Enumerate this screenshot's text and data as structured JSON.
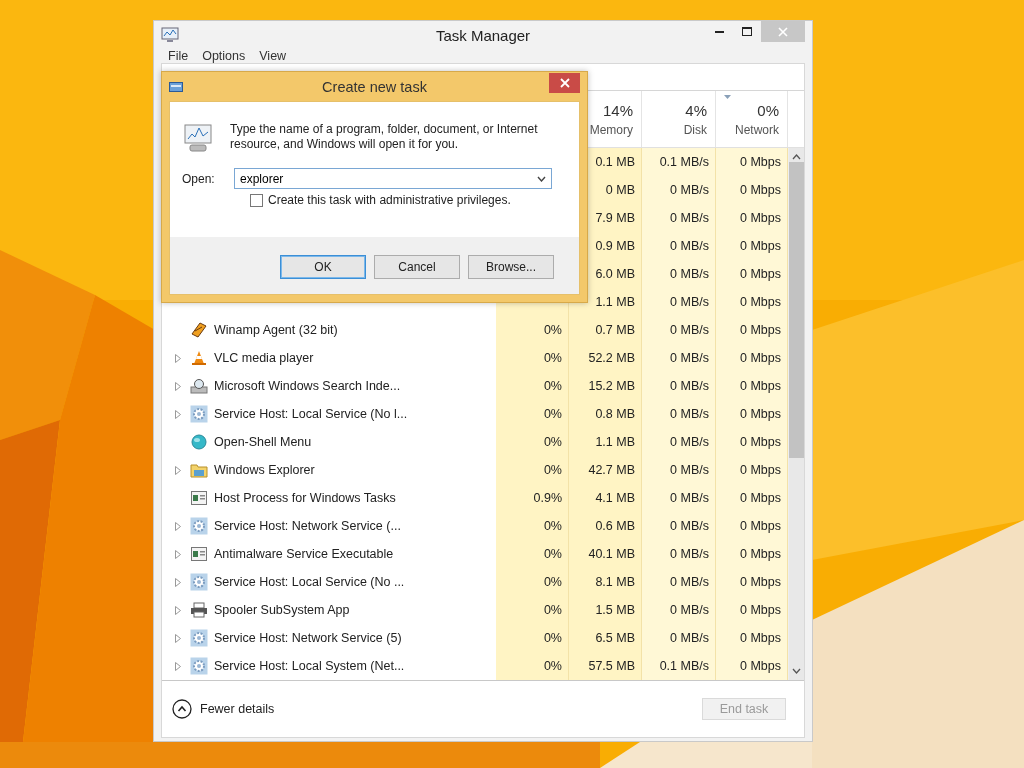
{
  "window": {
    "title": "Task Manager"
  },
  "menu": [
    "File",
    "Options",
    "View"
  ],
  "columns": [
    {
      "percent": "14%",
      "label": "Memory",
      "sorted": false
    },
    {
      "percent": "4%",
      "label": "Disk",
      "sorted": false
    },
    {
      "percent": "0%",
      "label": "Network",
      "sorted": true
    }
  ],
  "rows": [
    {
      "memory": "0.1 MB",
      "disk": "0.1 MB/s",
      "network": "0 Mbps",
      "expandable": false
    },
    {
      "memory": "0 MB",
      "disk": "0 MB/s",
      "network": "0 Mbps",
      "expandable": false
    },
    {
      "memory": "7.9 MB",
      "disk": "0 MB/s",
      "network": "0 Mbps",
      "expandable": false
    },
    {
      "memory": "0.9 MB",
      "disk": "0 MB/s",
      "network": "0 Mbps",
      "expandable": false
    },
    {
      "memory": "6.0 MB",
      "disk": "0 MB/s",
      "network": "0 Mbps",
      "expandable": false
    },
    {
      "memory": "1.1 MB",
      "disk": "0 MB/s",
      "network": "0 Mbps",
      "expandable": false
    },
    {
      "kind": "winamp",
      "name": "Winamp Agent (32 bit)",
      "cpu": "0%",
      "memory": "0.7 MB",
      "disk": "0 MB/s",
      "network": "0 Mbps",
      "expandable": false
    },
    {
      "kind": "cone",
      "name": "VLC media player",
      "cpu": "0%",
      "memory": "52.2 MB",
      "disk": "0 MB/s",
      "network": "0 Mbps",
      "expandable": true
    },
    {
      "kind": "search",
      "name": "Microsoft Windows Search Inde...",
      "cpu": "0%",
      "memory": "15.2 MB",
      "disk": "0 MB/s",
      "network": "0 Mbps",
      "expandable": true
    },
    {
      "kind": "service",
      "name": "Service Host: Local Service (No l...",
      "cpu": "0%",
      "memory": "0.8 MB",
      "disk": "0 MB/s",
      "network": "0 Mbps",
      "expandable": true
    },
    {
      "kind": "shell",
      "name": "Open-Shell Menu",
      "cpu": "0%",
      "memory": "1.1 MB",
      "disk": "0 MB/s",
      "network": "0 Mbps",
      "expandable": false
    },
    {
      "kind": "folder",
      "name": "Windows Explorer",
      "cpu": "0%",
      "memory": "42.7 MB",
      "disk": "0 MB/s",
      "network": "0 Mbps",
      "expandable": true
    },
    {
      "kind": "window",
      "name": "Host Process for Windows Tasks",
      "cpu": "0.9%",
      "memory": "4.1 MB",
      "disk": "0 MB/s",
      "network": "0 Mbps",
      "expandable": false
    },
    {
      "kind": "service",
      "name": "Service Host: Network Service (...",
      "cpu": "0%",
      "memory": "0.6 MB",
      "disk": "0 MB/s",
      "network": "0 Mbps",
      "expandable": true
    },
    {
      "kind": "window",
      "name": "Antimalware Service Executable",
      "cpu": "0%",
      "memory": "40.1 MB",
      "disk": "0 MB/s",
      "network": "0 Mbps",
      "expandable": true
    },
    {
      "kind": "service",
      "name": "Service Host: Local Service (No ...",
      "cpu": "0%",
      "memory": "8.1 MB",
      "disk": "0 MB/s",
      "network": "0 Mbps",
      "expandable": true
    },
    {
      "kind": "printer",
      "name": "Spooler SubSystem App",
      "cpu": "0%",
      "memory": "1.5 MB",
      "disk": "0 MB/s",
      "network": "0 Mbps",
      "expandable": true
    },
    {
      "kind": "service",
      "name": "Service Host: Network Service (5)",
      "cpu": "0%",
      "memory": "6.5 MB",
      "disk": "0 MB/s",
      "network": "0 Mbps",
      "expandable": true
    },
    {
      "kind": "service",
      "name": "Service Host: Local System (Net...",
      "cpu": "0%",
      "memory": "57.5 MB",
      "disk": "0.1 MB/s",
      "network": "0 Mbps",
      "expandable": true
    }
  ],
  "footer": {
    "toggle": "Fewer details",
    "end_task": {
      "label": "End task",
      "disabled": true
    }
  },
  "dialog": {
    "title": "Create new task",
    "message": "Type the name of a program, folder, document, or Internet resource, and Windows will open it for you.",
    "open_label": "Open:",
    "open_value": "explorer",
    "admin": {
      "label": "Create this task with administrative privileges.",
      "checked": false
    },
    "buttons": [
      {
        "label": "OK",
        "default": true
      },
      {
        "label": "Cancel",
        "default": false
      },
      {
        "label": "Browse...",
        "default": false
      }
    ]
  }
}
